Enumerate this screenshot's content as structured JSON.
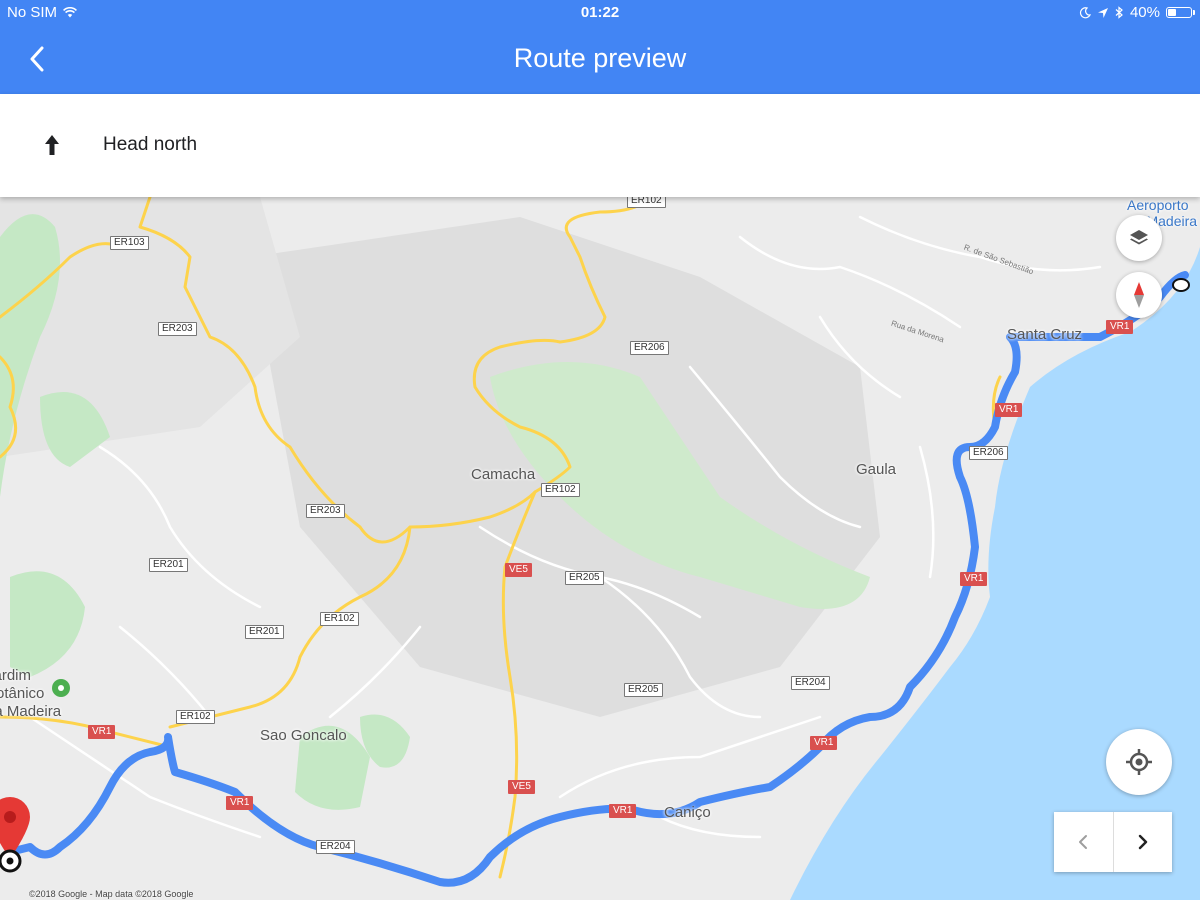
{
  "status_bar": {
    "carrier": "No SIM",
    "time": "01:22",
    "battery": "40%",
    "battery_level": 0.4
  },
  "app_bar": {
    "title": "Route preview"
  },
  "direction": {
    "icon": "arrow-up-icon",
    "instruction": "Head north"
  },
  "map": {
    "places": {
      "airport_line1": "Aeroporto",
      "airport_line2": "da Madeira",
      "santa_cruz": "Santa Cruz",
      "camacha": "Camacha",
      "gaula": "Gaula",
      "garden_line1": "Jardim",
      "garden_line2": "Botânico",
      "garden_line3": "da Madeira",
      "sao_goncalo": "Sao Goncalo",
      "canico": "Caniço"
    },
    "streets": {
      "sao_sebastiao": "R. de São Sebastião",
      "rua_morena": "Rua da Morena"
    },
    "road_shields": {
      "er102": "ER102",
      "er103": "ER103",
      "er203": "ER203",
      "er206": "ER206",
      "er201": "ER201",
      "er205": "ER205",
      "er204": "ER204",
      "vr1": "VR1",
      "ve5": "VE5"
    },
    "copyright": "©2018 Google - Map data ©2018 Google",
    "colors": {
      "route": "#4a8af4",
      "water": "#aadaff",
      "park": "#c5e8c5",
      "major_road": "#fdd34c",
      "shield_red": "#d9504f",
      "marker": "#e53935"
    }
  },
  "controls": {
    "layers_icon": "layers-icon",
    "compass_icon": "compass-icon",
    "my_location_icon": "my-location-icon",
    "prev_icon": "chevron-left-icon",
    "next_icon": "chevron-right-icon"
  }
}
